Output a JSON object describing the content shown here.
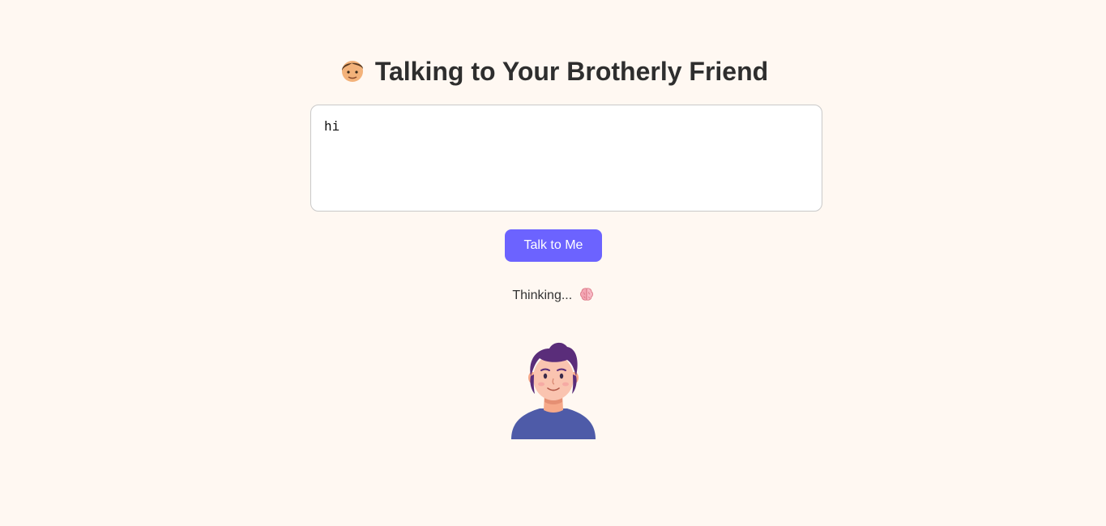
{
  "header": {
    "title": "Talking to Your Brotherly Friend",
    "title_icon": "person-icon"
  },
  "input": {
    "value": "hi"
  },
  "actions": {
    "talk_label": "Talk to Me"
  },
  "status": {
    "text": "Thinking...",
    "icon": "brain-icon"
  },
  "avatar": {
    "icon": "friend-avatar"
  },
  "colors": {
    "background": "#fff8f2",
    "accent": "#6c63ff",
    "title_text": "#2e2e2e"
  }
}
